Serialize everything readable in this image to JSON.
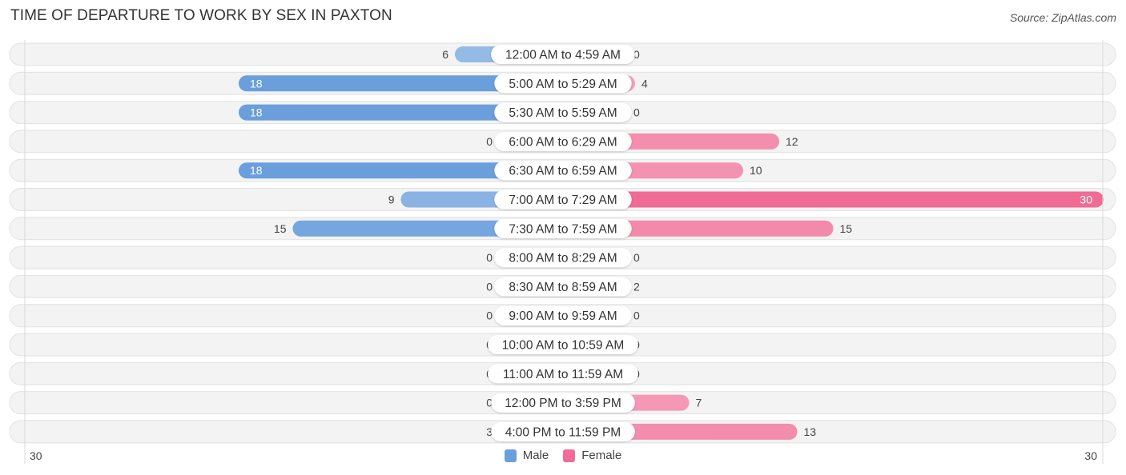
{
  "header": {
    "title": "TIME OF DEPARTURE TO WORK BY SEX IN PAXTON",
    "source": "Source: ZipAtlas.com"
  },
  "colors": {
    "male": "#6a9fdc",
    "male_light": "#a9c7eb",
    "female": "#f06b95",
    "female_light": "#f6a6c0",
    "row_bg": "#f3f3f3",
    "label_bg": "#ffffff"
  },
  "chart_data": {
    "type": "bar",
    "orientation": "horizontal-diverging",
    "title": "TIME OF DEPARTURE TO WORK BY SEX IN PAXTON",
    "categories": [
      "12:00 AM to 4:59 AM",
      "5:00 AM to 5:29 AM",
      "5:30 AM to 5:59 AM",
      "6:00 AM to 6:29 AM",
      "6:30 AM to 6:59 AM",
      "7:00 AM to 7:29 AM",
      "7:30 AM to 7:59 AM",
      "8:00 AM to 8:29 AM",
      "8:30 AM to 8:59 AM",
      "9:00 AM to 9:59 AM",
      "10:00 AM to 10:59 AM",
      "11:00 AM to 11:59 AM",
      "12:00 PM to 3:59 PM",
      "4:00 PM to 11:59 PM"
    ],
    "series": [
      {
        "name": "Male",
        "values": [
          6,
          18,
          18,
          0,
          18,
          9,
          15,
          0,
          0,
          0,
          0,
          0,
          0,
          3
        ]
      },
      {
        "name": "Female",
        "values": [
          0,
          4,
          0,
          12,
          10,
          30,
          15,
          0,
          2,
          0,
          0,
          0,
          7,
          13
        ]
      }
    ],
    "xlim": [
      -30,
      30
    ],
    "axis_tick_labels": {
      "left": "30",
      "right": "30"
    },
    "legend": {
      "position": "bottom-center",
      "entries": [
        "Male",
        "Female"
      ]
    },
    "grid": false
  }
}
